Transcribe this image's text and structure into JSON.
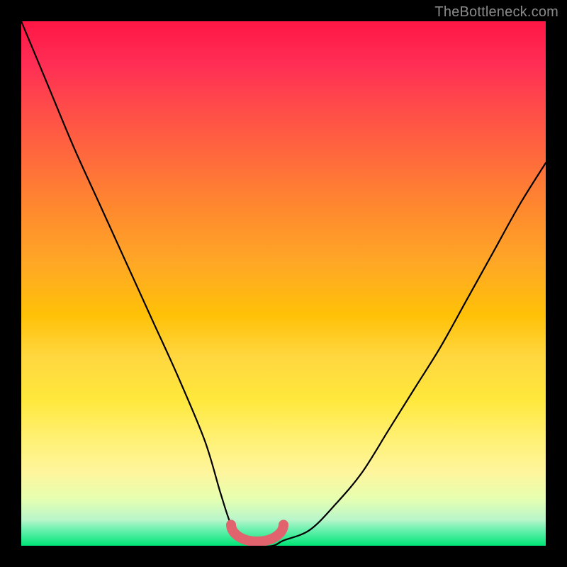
{
  "watermark": "TheBottleneck.com",
  "colors": {
    "curve": "#000000",
    "trough": "#e0636d",
    "frame": "#000000"
  },
  "chart_data": {
    "type": "line",
    "title": "",
    "xlabel": "",
    "ylabel": "",
    "xlim": [
      0,
      100
    ],
    "ylim": [
      0,
      100
    ],
    "grid": false,
    "series": [
      {
        "name": "bottleneck-curve",
        "x": [
          0,
          5,
          10,
          15,
          20,
          25,
          30,
          35,
          38,
          40,
          42,
          45,
          48,
          50,
          55,
          60,
          65,
          70,
          75,
          80,
          85,
          90,
          95,
          100
        ],
        "y": [
          100,
          88,
          76,
          65,
          54,
          43,
          32,
          20,
          10,
          4,
          1,
          0,
          0,
          1,
          3,
          8,
          14,
          22,
          30,
          38,
          47,
          56,
          65,
          73
        ]
      }
    ],
    "trough": {
      "x_start": 40,
      "x_end": 50,
      "y_cap": 4
    }
  }
}
